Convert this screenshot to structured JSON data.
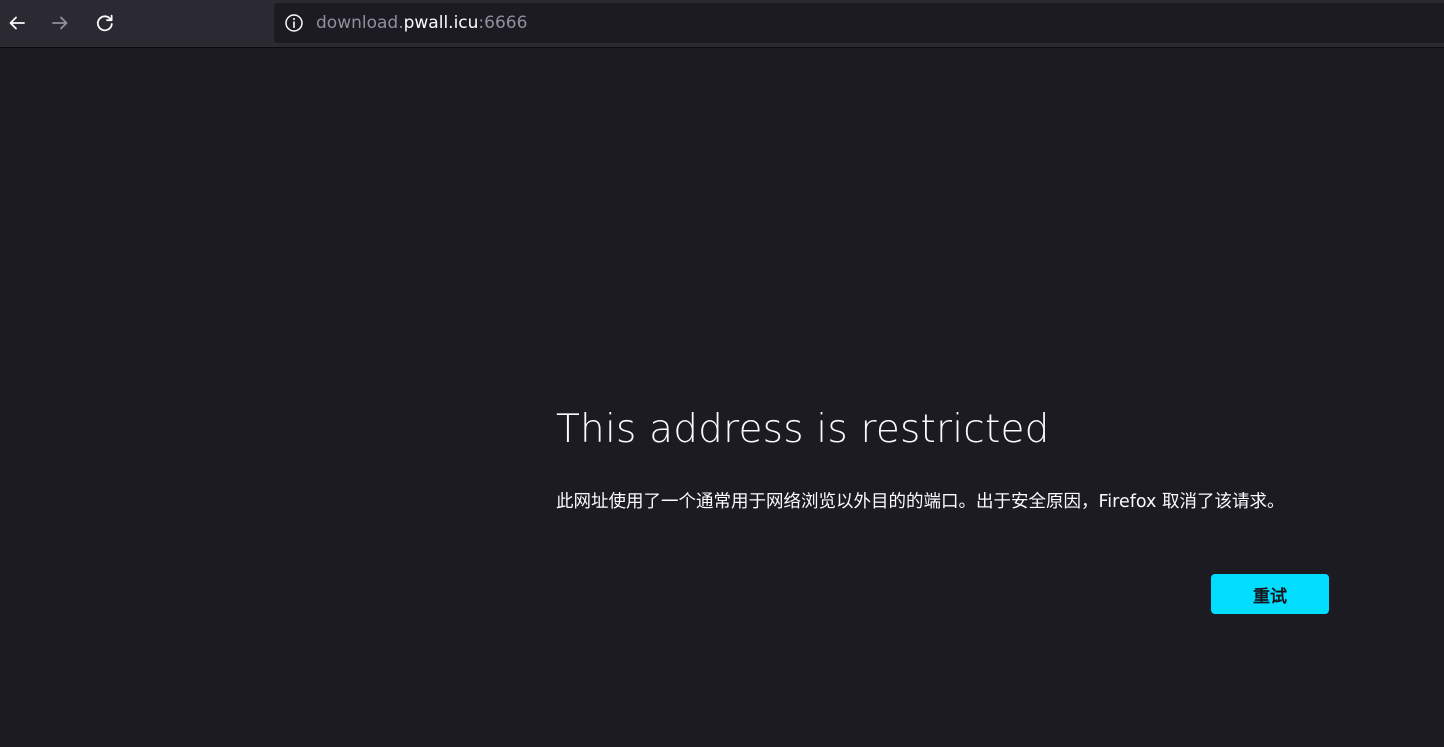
{
  "browser": {
    "url": {
      "prefix": "download.",
      "host": "pwall.icu",
      "suffix": ":6666"
    },
    "icons": {
      "back": "arrow-left-icon",
      "forward": "arrow-right-icon",
      "reload": "reload-icon",
      "site_info": "info-icon"
    }
  },
  "error_page": {
    "title": "This address is restricted",
    "description": "此网址使用了一个通常用于网络浏览以外目的的端口。出于安全原因，Firefox 取消了该请求。",
    "retry_label": "重试"
  },
  "colors": {
    "background": "#1c1b22",
    "toolbar": "#2b2a33",
    "accent": "#00ddff",
    "text": "#fbfbfe",
    "muted": "#8f8f9d"
  }
}
